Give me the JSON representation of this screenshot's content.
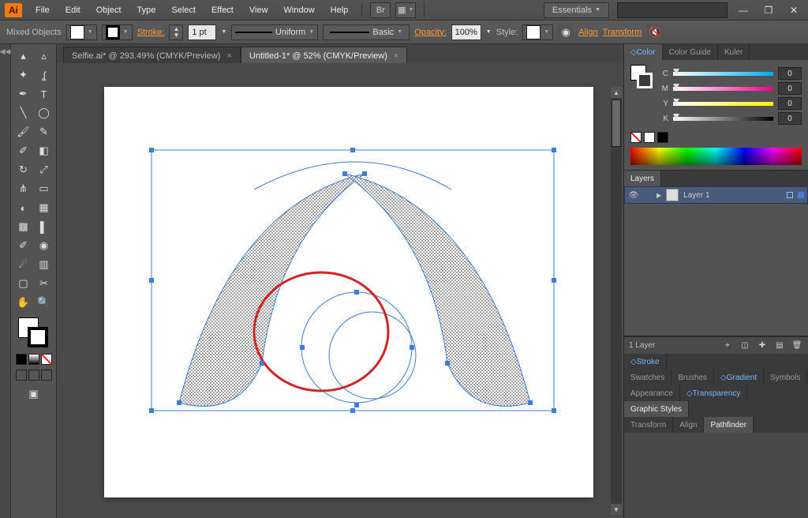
{
  "app": {
    "icon_text": "Ai"
  },
  "menu": [
    "File",
    "Edit",
    "Object",
    "Type",
    "Select",
    "Effect",
    "View",
    "Window",
    "Help"
  ],
  "workspace": "Essentials",
  "ctrl": {
    "selection": "Mixed Objects",
    "stroke_label": "Stroke:",
    "stroke_weight": "1 pt",
    "stroke_profile": "Uniform",
    "brush_def": "Basic",
    "opacity_label": "Opacity:",
    "opacity_value": "100%",
    "style_label": "Style:",
    "align_label": "Align",
    "transform_label": "Transform"
  },
  "tabs": [
    {
      "title": "Selfie.ai* @ 293.49% (CMYK/Preview)",
      "active": false
    },
    {
      "title": "Untitled-1* @ 52% (CMYK/Preview)",
      "active": true
    }
  ],
  "color_panel": {
    "tabs": [
      "Color",
      "Color Guide",
      "Kuler"
    ],
    "active": 0,
    "channels": [
      {
        "ch": "C",
        "val": "0",
        "grad": "linear-gradient(90deg,#fff,#00aeef)"
      },
      {
        "ch": "M",
        "val": "0",
        "grad": "linear-gradient(90deg,#fff,#ec008c)"
      },
      {
        "ch": "Y",
        "val": "0",
        "grad": "linear-gradient(90deg,#fff,#fff200)"
      },
      {
        "ch": "K",
        "val": "0",
        "grad": "linear-gradient(90deg,#fff,#000)"
      }
    ]
  },
  "layers_panel": {
    "tab": "Layers",
    "layer_name": "Layer 1",
    "footer": "1 Layer"
  },
  "side_tabs_a": {
    "tabs": [
      "Stroke"
    ],
    "accent": [
      0
    ]
  },
  "side_tabs_b": {
    "tabs": [
      "Swatches",
      "Brushes",
      "Gradient",
      "Symbols"
    ],
    "accent": [
      2
    ]
  },
  "side_tabs_c": {
    "tabs": [
      "Appearance",
      "Transparency"
    ],
    "accent": [
      1
    ]
  },
  "side_tabs_d": {
    "tabs": [
      "Graphic Styles"
    ],
    "accent": []
  },
  "side_tabs_e": {
    "tabs": [
      "Transform",
      "Align",
      "Pathfinder"
    ],
    "accent": []
  }
}
